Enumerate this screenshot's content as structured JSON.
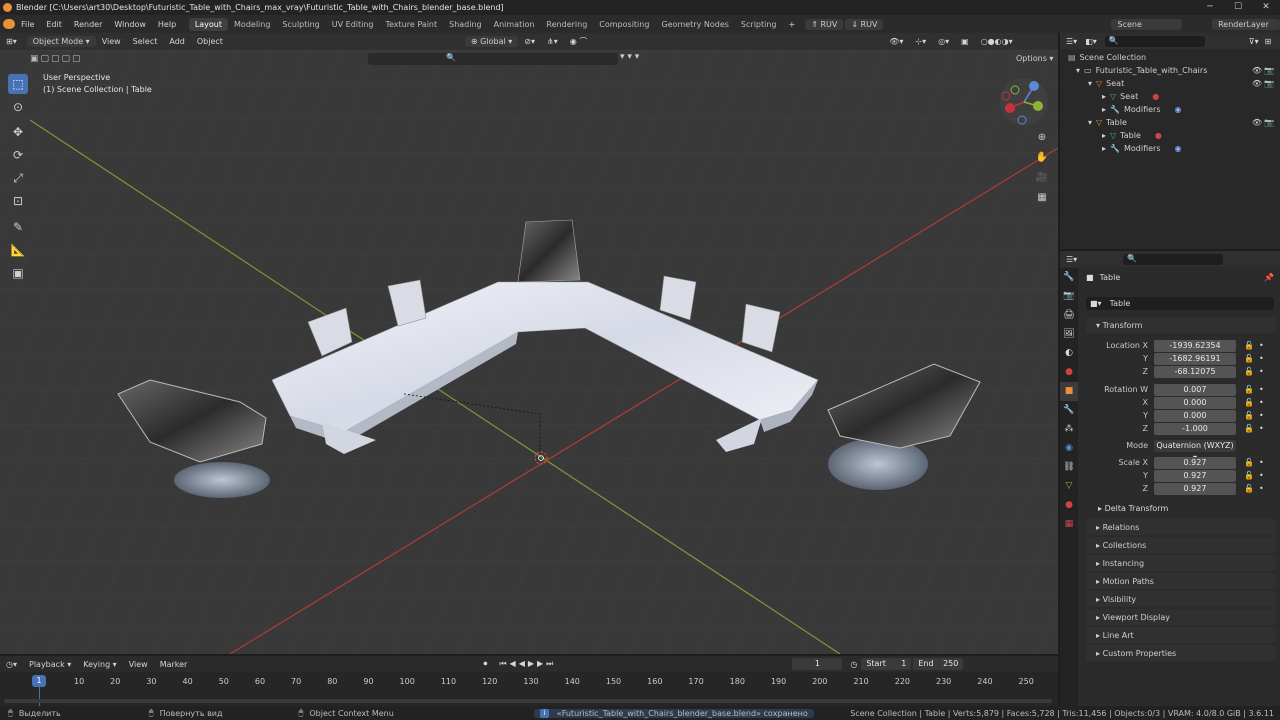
{
  "window": {
    "title": "Blender [C:\\Users\\art30\\Desktop\\Futuristic_Table_with_Chairs_max_vray\\Futuristic_Table_with_Chairs_blender_base.blend]"
  },
  "menu": {
    "file": "File",
    "edit": "Edit",
    "render": "Render",
    "window": "Window",
    "help": "Help"
  },
  "workspaces": [
    "Layout",
    "Modeling",
    "Sculpting",
    "UV Editing",
    "Texture Paint",
    "Shading",
    "Animation",
    "Rendering",
    "Compositing",
    "Geometry Nodes",
    "Scripting"
  ],
  "top_right": {
    "ruv1": "RUV",
    "ruv2": "RUV",
    "scene": "Scene",
    "render_layer": "RenderLayer"
  },
  "viewport_header": {
    "mode": "Object Mode",
    "view": "View",
    "select": "Select",
    "add": "Add",
    "object": "Object",
    "orientation": "Global",
    "options": "Options"
  },
  "viewport": {
    "perspective": "User Perspective",
    "collection": "(1) Scene Collection | Table"
  },
  "outliner": {
    "root": "Scene Collection",
    "items": [
      "Futuristic_Table_with_Chairs",
      "Seat",
      "Seat",
      "Modifiers",
      "Table",
      "Table",
      "Modifiers"
    ]
  },
  "properties": {
    "object_name": "Table",
    "data_name": "Table",
    "transform": "Transform",
    "location_label": "Location X",
    "loc_x": "-1939.62354",
    "loc_y": "-1682.96191",
    "loc_z": "-68.12075",
    "rotation_label": "Rotation W",
    "rot_w": "0.007",
    "rot_x": "0.000",
    "rot_y": "0.000",
    "rot_z": "-1.000",
    "mode_label": "Mode",
    "mode": "Quaternion (WXYZ)",
    "scale_label": "Scale X",
    "scale_x": "0.927",
    "scale_y": "0.927",
    "scale_z": "0.927",
    "axis_x": "X",
    "axis_y": "Y",
    "axis_z": "Z",
    "delta": "Delta Transform",
    "panels": [
      "Relations",
      "Collections",
      "Instancing",
      "Motion Paths",
      "Visibility",
      "Viewport Display",
      "Line Art",
      "Custom Properties"
    ]
  },
  "timeline": {
    "playback": "Playback",
    "keying": "Keying",
    "view": "View",
    "marker": "Marker",
    "current": "1",
    "start_label": "Start",
    "start": "1",
    "end_label": "End",
    "end": "250",
    "ticks": [
      "1",
      "10",
      "20",
      "30",
      "40",
      "50",
      "60",
      "70",
      "80",
      "90",
      "100",
      "110",
      "120",
      "130",
      "140",
      "150",
      "160",
      "170",
      "180",
      "190",
      "200",
      "210",
      "220",
      "230",
      "240",
      "250"
    ]
  },
  "status": {
    "select": "Выделить",
    "rotate": "Повернуть вид",
    "context": "Object Context Menu",
    "message": "«Futuristic_Table_with_Chairs_blender_base.blend» сохранено",
    "stats": "Scene Collection | Table | Verts:5,879 | Faces:5,728 | Tris:11,456 | Objects:0/3 | VRAM: 4.0/8.0 GiB | 3.6.11"
  },
  "colors": {
    "accent": "#4772b3",
    "axis_x": "#c8323c",
    "axis_y": "#8db337",
    "orange": "#e8913a"
  }
}
